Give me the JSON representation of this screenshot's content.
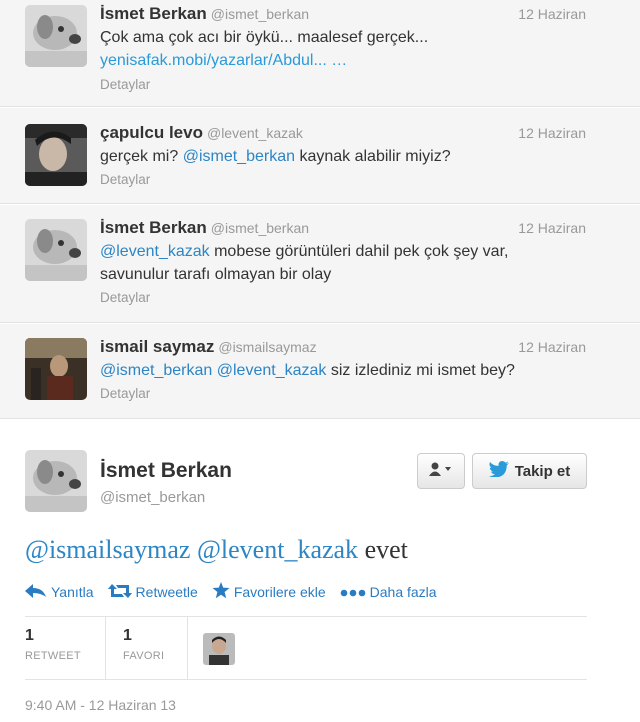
{
  "replies": [
    {
      "name": "İsmet Berkan",
      "handle": "@ismet_berkan",
      "time": "12 Haziran",
      "text_line1": "Çok ama çok acı bir öykü... maalesef gerçek...",
      "link": "yenisafak.mobi/yazarlar/Abdul... …",
      "details": "Detaylar"
    },
    {
      "name": "çapulcu levo",
      "handle": "@levent_kazak",
      "time": "12 Haziran",
      "text_pre": "gerçek mi? ",
      "mention": "@ismet_berkan",
      "text_post": " kaynak alabilir miyiz?",
      "details": "Detaylar"
    },
    {
      "name": "İsmet Berkan",
      "handle": "@ismet_berkan",
      "time": "12 Haziran",
      "mention": "@levent_kazak",
      "text_post": " mobese görüntüleri dahil pek çok şey var,",
      "text_line2": "savunulur tarafı olmayan bir olay",
      "details": "Detaylar"
    },
    {
      "name": "ismail saymaz",
      "handle": "@ismailsaymaz",
      "time": "12 Haziran",
      "mention1": "@ismet_berkan",
      "mention2": "@levent_kazak",
      "text_post": " siz izlediniz mi ismet bey?",
      "details": "Detaylar"
    }
  ],
  "main_tweet": {
    "name": "İsmet Berkan",
    "handle": "@ismet_berkan",
    "follow_label": "Takip et",
    "mention1": "@ismailsaymaz",
    "mention2": "@levent_kazak",
    "text": " evet",
    "actions": {
      "reply": "Yanıtla",
      "retweet": "Retweetle",
      "favorite": "Favorilere ekle",
      "more": "Daha fazla"
    },
    "stats": {
      "retweet_count": "1",
      "retweet_label": "RETWEET",
      "favorite_count": "1",
      "favorite_label": "FAVORI"
    },
    "timestamp": "9:40 AM - 12 Haziran 13"
  },
  "colors": {
    "link": "#2a9ad8",
    "mention": "#2c85c4",
    "muted": "#999999",
    "reply_bg": "#f5f5f5"
  },
  "icons": {
    "reply": "reply-arrow-icon",
    "retweet": "retweet-icon",
    "favorite": "star-icon",
    "more": "ellipsis-icon",
    "follow": "twitter-bird-icon",
    "user_menu": "user-dropdown-icon"
  }
}
